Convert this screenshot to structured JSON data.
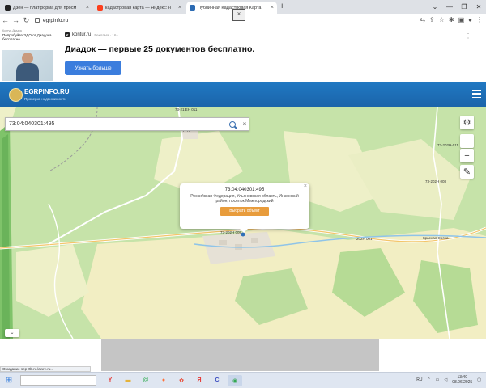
{
  "browser": {
    "tabs": [
      {
        "title": "Дзен — платформа для просм",
        "icon_color": "#222222",
        "active": false
      },
      {
        "title": "кадастровая карта — Яндекс: н",
        "icon_color": "#fc3f1d",
        "active": false
      },
      {
        "title": "Публичная Кадастровая Карта",
        "icon_color": "#2c6bb3",
        "active": true
      }
    ],
    "new_tab": "+",
    "url": "egrpinfo.ru"
  },
  "ad": {
    "brand": "Контур.Диадок",
    "tagline": "Попробуйте ЭДО от Диадока бесплатно",
    "site": "kontur.ru",
    "ad_marker": "Реклама · 16+",
    "headline": "Диадок — первые 25 документов бесплатно.",
    "button": "Узнать больше",
    "menu": "⋮"
  },
  "site": {
    "logo": "EGRPINFO.RU",
    "subtitle": "Проверка недвижимости"
  },
  "search": {
    "value": "73:04:040301:495",
    "clear": "×"
  },
  "map_controls": {
    "settings": "⚙",
    "zoom_in": "+",
    "zoom_out": "−",
    "ruler": "✎",
    "collapse": "⌄"
  },
  "popup": {
    "title": "73:04:040301:495",
    "address": "Российская Федерация, Ульяновская область, Инзенский район, поселок Межпородский",
    "button": "Выбрать объект",
    "close": "×"
  },
  "map_labels": [
    "73-21:ЕН 011",
    "Межпородский",
    "73-202Н 008",
    "73-202Н-011",
    "73-202Н 008",
    "202Н 001",
    "Красная Сосна"
  ],
  "status_text": "Ожидание sep-rtb.ru.lawre.ru...",
  "taskbar": {
    "lang": "RU",
    "time": "13:40",
    "date": "08.06.2025"
  },
  "colors": {
    "header": "#1f6fb8",
    "map_green": "#c6e3a9",
    "forest": "#a9d18c",
    "field": "#f2eec3",
    "road": "#ffffff",
    "popup_button": "#e89c3c"
  }
}
